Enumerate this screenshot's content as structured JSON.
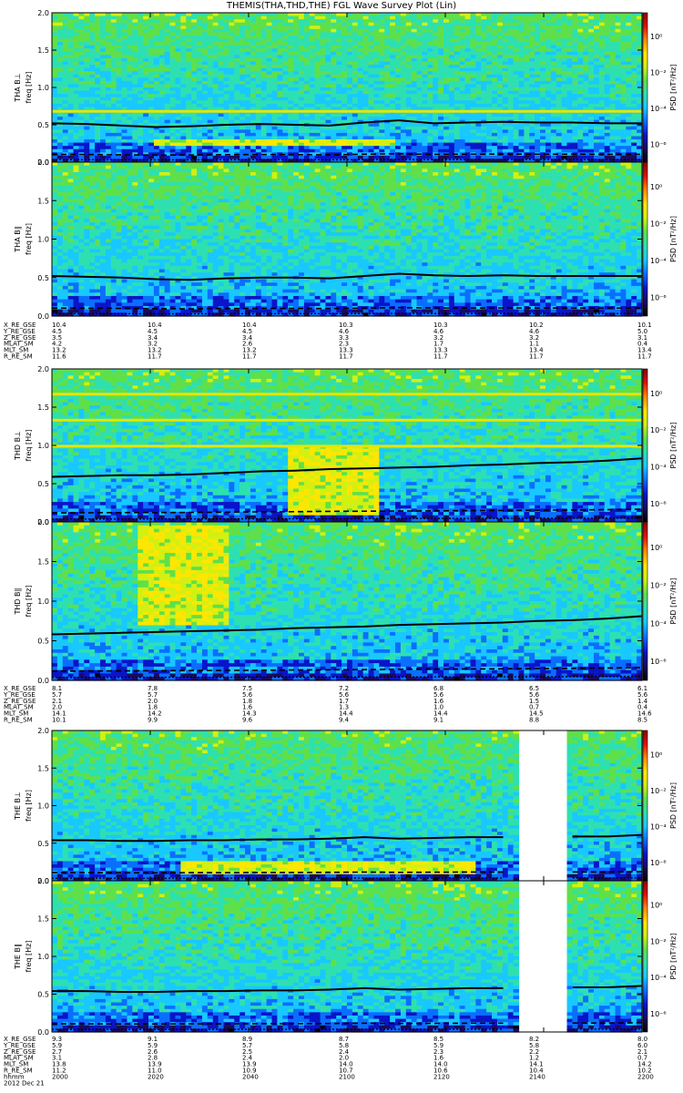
{
  "title": "THEMIS(THA,THD,THE) FGL Wave Survey Plot (Lin)",
  "colors": {
    "colormap": [
      "#000000",
      "#1a0a60",
      "#0a14c8",
      "#0a6eff",
      "#18c8ff",
      "#2ee0b0",
      "#5fe04a",
      "#d2f012",
      "#ffe600",
      "#ff8a00",
      "#e01010",
      "#8a0000"
    ]
  },
  "chart_data": [
    {
      "type": "heatmap",
      "probe": "THA",
      "component": "B⊥",
      "ylabel": "THA B⊥\nfreq [Hz]",
      "ylim": [
        0,
        2
      ],
      "yticks": [
        "0.0",
        "0.5",
        "1.0",
        "1.5",
        "2.0"
      ],
      "colorbar": {
        "label": "PSD [nT²/Hz]",
        "ticks": [
          "10⁰",
          "10⁻²",
          "10⁻⁴",
          "10⁻⁶"
        ]
      },
      "gyro_line_hz": [
        0.52,
        0.51,
        0.49,
        0.47,
        0.48,
        0.5,
        0.51,
        0.5,
        0.49,
        0.53,
        0.56,
        0.52,
        0.53,
        0.54,
        0.53,
        0.53,
        0.52,
        0.52
      ],
      "emissions": [
        {
          "f0": 0.2,
          "f1": 0.32,
          "x0": 0.17,
          "x1": 0.58
        }
      ],
      "lines_hz": [
        0.68
      ],
      "gaps": []
    },
    {
      "type": "heatmap",
      "probe": "THA",
      "component": "B∥",
      "ylabel": "THA B∥\nfreq [Hz]",
      "ylim": [
        0,
        2
      ],
      "yticks": [
        "0.0",
        "0.5",
        "1.0",
        "1.5",
        "2.0"
      ],
      "colorbar": {
        "label": "PSD [nT²/Hz]",
        "ticks": [
          "10⁰",
          "10⁻²",
          "10⁻⁴",
          "10⁻⁶"
        ]
      },
      "gyro_line_hz": [
        0.52,
        0.51,
        0.5,
        0.48,
        0.47,
        0.49,
        0.5,
        0.5,
        0.49,
        0.52,
        0.55,
        0.53,
        0.52,
        0.53,
        0.52,
        0.52,
        0.52,
        0.52
      ],
      "emissions": [],
      "lines_hz": [],
      "gaps": []
    },
    {
      "type": "heatmap",
      "probe": "THD",
      "component": "B⊥",
      "ylabel": "THD B⊥\nfreq [Hz]",
      "ylim": [
        0,
        2
      ],
      "yticks": [
        "0.0",
        "0.5",
        "1.0",
        "1.5",
        "2.0"
      ],
      "colorbar": {
        "label": "PSD [nT²/Hz]",
        "ticks": [
          "10⁰",
          "10⁻²",
          "10⁻⁴",
          "10⁻⁶"
        ]
      },
      "gyro_line_hz": [
        0.59,
        0.6,
        0.61,
        0.61,
        0.62,
        0.64,
        0.66,
        0.67,
        0.69,
        0.7,
        0.71,
        0.72,
        0.74,
        0.75,
        0.77,
        0.78,
        0.8,
        0.83
      ],
      "emissions": [
        {
          "f0": 0.1,
          "f1": 1.0,
          "x0": 0.4,
          "x1": 0.55
        }
      ],
      "lines_hz": [
        0.99,
        1.33,
        1.67
      ],
      "gaps": []
    },
    {
      "type": "heatmap",
      "probe": "THD",
      "component": "B∥",
      "ylabel": "THD B∥\nfreq [Hz]",
      "ylim": [
        0,
        2
      ],
      "yticks": [
        "0.0",
        "0.5",
        "1.0",
        "1.5",
        "2.0"
      ],
      "colorbar": {
        "label": "PSD [nT²/Hz]",
        "ticks": [
          "10⁰",
          "10⁻²",
          "10⁻⁴",
          "10⁻⁶"
        ]
      },
      "gyro_line_hz": [
        0.58,
        0.59,
        0.6,
        0.61,
        0.62,
        0.63,
        0.64,
        0.66,
        0.67,
        0.68,
        0.7,
        0.71,
        0.72,
        0.73,
        0.75,
        0.76,
        0.78,
        0.81
      ],
      "emissions": [
        {
          "f0": 0.7,
          "f1": 1.95,
          "x0": 0.15,
          "x1": 0.3
        }
      ],
      "lines_hz": [],
      "gaps": []
    },
    {
      "type": "heatmap",
      "probe": "THE",
      "component": "B⊥",
      "ylabel": "THE B⊥\nfreq [Hz]",
      "ylim": [
        0,
        2
      ],
      "yticks": [
        "0.0",
        "0.5",
        "1.0",
        "1.5",
        "2.0"
      ],
      "colorbar": {
        "label": "PSD [nT²/Hz]",
        "ticks": [
          "10⁰",
          "10⁻²",
          "10⁻⁴",
          "10⁻⁶"
        ]
      },
      "gyro_line_hz": [
        0.54,
        0.54,
        0.53,
        0.53,
        0.54,
        0.54,
        0.55,
        0.55,
        0.56,
        0.58,
        0.56,
        0.57,
        0.58,
        0.58,
        0.58,
        0.59,
        0.59,
        0.61
      ],
      "emissions": [
        {
          "f0": 0.1,
          "f1": 0.25,
          "x0": 0.22,
          "x1": 0.72
        }
      ],
      "lines_hz": [],
      "gaps": [
        [
          0.79,
          0.876
        ]
      ]
    },
    {
      "type": "heatmap",
      "probe": "THE",
      "component": "B∥",
      "ylabel": "THE B∥\nfreq [Hz]",
      "ylim": [
        0,
        2
      ],
      "yticks": [
        "0.0",
        "0.5",
        "1.0",
        "1.5",
        "2.0"
      ],
      "colorbar": {
        "label": "PSD [nT²/Hz]",
        "ticks": [
          "10⁰",
          "10⁻²",
          "10⁻⁴",
          "10⁻⁶"
        ]
      },
      "gyro_line_hz": [
        0.54,
        0.54,
        0.53,
        0.53,
        0.54,
        0.54,
        0.55,
        0.55,
        0.56,
        0.58,
        0.56,
        0.57,
        0.58,
        0.58,
        0.58,
        0.59,
        0.59,
        0.61
      ],
      "emissions": [],
      "lines_hz": [],
      "gaps": [
        [
          0.79,
          0.876
        ]
      ]
    }
  ],
  "ephemeris": [
    {
      "rows": [
        {
          "label": "X_RE_GSE",
          "values": [
            "10.4",
            "10.4",
            "10.4",
            "10.3",
            "10.3",
            "10.2",
            "10.1"
          ]
        },
        {
          "label": "Y_RE_GSE",
          "values": [
            "4.5",
            "4.5",
            "4.5",
            "4.6",
            "4.6",
            "4.6",
            "5.0"
          ]
        },
        {
          "label": "Z_RE_GSE",
          "values": [
            "3.5",
            "3.4",
            "3.4",
            "3.3",
            "3.2",
            "3.2",
            "3.1"
          ]
        },
        {
          "label": "MLAT_SM",
          "values": [
            "4.2",
            "3.2",
            "2.6",
            "2.3",
            "1.7",
            "1.1",
            "0.4"
          ]
        },
        {
          "label": "MLT_SM",
          "values": [
            "13.2",
            "13.2",
            "13.2",
            "13.3",
            "13.3",
            "13.4",
            "13.4"
          ]
        },
        {
          "label": "R_RE_SM",
          "values": [
            "11.6",
            "11.7",
            "11.7",
            "11.7",
            "11.7",
            "11.7",
            "11.7"
          ]
        }
      ]
    },
    {
      "rows": [
        {
          "label": "X_RE_GSE",
          "values": [
            "8.1",
            "7.8",
            "7.5",
            "7.2",
            "6.8",
            "6.5",
            "6.1"
          ]
        },
        {
          "label": "Y_RE_GSE",
          "values": [
            "5.7",
            "5.7",
            "5.6",
            "5.6",
            "5.6",
            "5.6",
            "5.6"
          ]
        },
        {
          "label": "Z_RE_GSE",
          "values": [
            "2.1",
            "2.0",
            "1.8",
            "1.7",
            "1.6",
            "1.5",
            "1.4"
          ]
        },
        {
          "label": "MLAT_SM",
          "values": [
            "2.0",
            "1.8",
            "1.6",
            "1.3",
            "1.0",
            "0.7",
            "0.4"
          ]
        },
        {
          "label": "MLT_SM",
          "values": [
            "14.1",
            "14.2",
            "14.3",
            "14.4",
            "14.4",
            "14.5",
            "14.6"
          ]
        },
        {
          "label": "R_RE_SM",
          "values": [
            "10.1",
            "9.9",
            "9.6",
            "9.4",
            "9.1",
            "8.8",
            "8.5"
          ]
        }
      ]
    },
    {
      "rows": [
        {
          "label": "X_RE_GSE",
          "values": [
            "9.3",
            "9.1",
            "8.9",
            "8.7",
            "8.5",
            "8.2",
            "8.0"
          ]
        },
        {
          "label": "Y_RE_GSE",
          "values": [
            "5.9",
            "5.9",
            "5.7",
            "5.8",
            "5.9",
            "5.8",
            "6.0"
          ]
        },
        {
          "label": "Z_RE_GSE",
          "values": [
            "2.7",
            "2.6",
            "2.5",
            "2.4",
            "2.3",
            "2.2",
            "2.1"
          ]
        },
        {
          "label": "MLAT_SM",
          "values": [
            "3.1",
            "2.8",
            "2.4",
            "2.0",
            "1.6",
            "1.2",
            "0.7"
          ]
        },
        {
          "label": "MLT_SM",
          "values": [
            "13.8",
            "13.9",
            "13.9",
            "14.0",
            "14.0",
            "14.1",
            "14.2"
          ]
        },
        {
          "label": "R_RE_SM",
          "values": [
            "11.2",
            "11.0",
            "10.9",
            "10.7",
            "10.6",
            "10.4",
            "10.2"
          ]
        },
        {
          "label": "hhmm",
          "values": [
            "2000",
            "2020",
            "2040",
            "2100",
            "2120",
            "2140",
            "2200"
          ]
        },
        {
          "label": "2012 Dec 21",
          "values": []
        }
      ]
    }
  ]
}
